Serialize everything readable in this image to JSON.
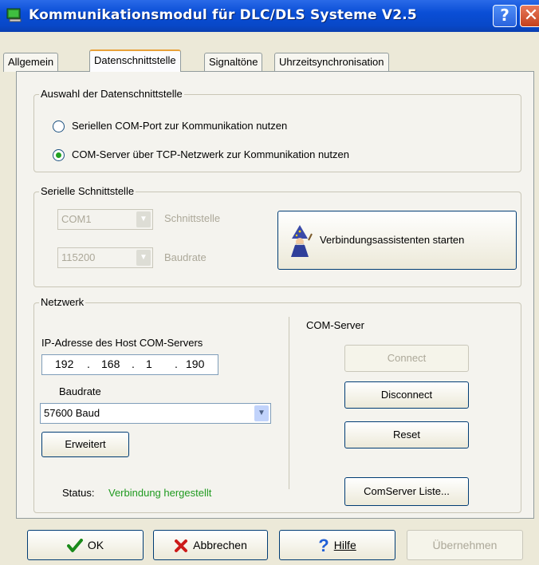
{
  "window": {
    "title": "Kommunikationsmodul für DLC/DLS Systeme V2.5",
    "help_glyph": "?",
    "close_glyph": "✕"
  },
  "tabs": [
    {
      "label": "Allgemein",
      "active": false
    },
    {
      "label": "Datenschnittstelle",
      "active": true
    },
    {
      "label": "Signaltöne",
      "active": false
    },
    {
      "label": "Uhrzeitsynchronisation",
      "active": false
    }
  ],
  "interface_group": {
    "legend": "Auswahl der Datenschnittstelle",
    "options": [
      {
        "label": "Seriellen COM-Port zur Kommunikation nutzen",
        "checked": false
      },
      {
        "label": "COM-Server über TCP-Netzwerk zur Kommunikation nutzen",
        "checked": true
      }
    ]
  },
  "serial_group": {
    "legend": "Serielle Schnittstelle",
    "port": {
      "value": "COM1",
      "label": "Schnittstelle",
      "enabled": false
    },
    "baud": {
      "value": "115200",
      "label": "Baudrate",
      "enabled": false
    },
    "wizard_button": "Verbindungsassistenten starten",
    "wizard_icon": "wizard-icon"
  },
  "network_group": {
    "legend": "Netzwerk",
    "ip_label": "IP-Adresse des Host COM-Servers",
    "ip": [
      "192",
      "168",
      "1",
      "190"
    ],
    "ip_separator": ".",
    "baud_label": "Baudrate",
    "baud_value": "57600 Baud",
    "advanced_button": "Erweitert",
    "status_label": "Status:",
    "status_value": "Verbindung hergestellt",
    "status_color": "#1f9a1f",
    "com_server_title": "COM-Server",
    "connect_button": "Connect",
    "disconnect_button": "Disconnect",
    "reset_button": "Reset",
    "list_button": "ComServer Liste..."
  },
  "footer": {
    "ok": "OK",
    "cancel": "Abbrechen",
    "help": "Hilfe",
    "apply": "Übernehmen",
    "ok_icon": "checkmark-icon",
    "cancel_icon": "red-x-icon",
    "help_icon": "question-icon"
  },
  "colors": {
    "title_bar": "#0a4ed6",
    "status_text": "#1f9a1f",
    "tab_highlight": "#e8a13a"
  }
}
